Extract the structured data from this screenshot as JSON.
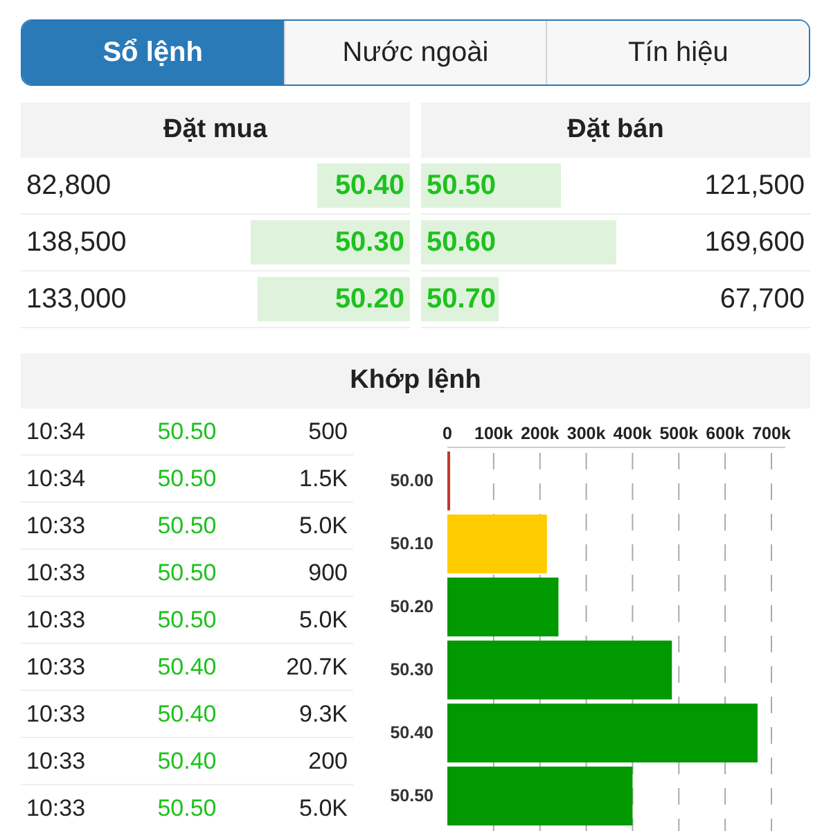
{
  "tabs": [
    {
      "label": "Sổ lệnh",
      "selected": true
    },
    {
      "label": "Nước ngoài",
      "selected": false
    },
    {
      "label": "Tín hiệu",
      "selected": false
    }
  ],
  "order_book": {
    "buy_header": "Đặt mua",
    "sell_header": "Đặt bán",
    "rows": [
      {
        "buy": {
          "volume": "82,800",
          "price": "50.40",
          "level": 0.24
        },
        "sell": {
          "price": "50.50",
          "level": 0.36,
          "volume": "121,500"
        }
      },
      {
        "buy": {
          "volume": "138,500",
          "price": "50.30",
          "level": 0.41
        },
        "sell": {
          "price": "50.60",
          "level": 0.5,
          "volume": "169,600"
        }
      },
      {
        "buy": {
          "volume": "133,000",
          "price": "50.20",
          "level": 0.39
        },
        "sell": {
          "price": "50.70",
          "level": 0.2,
          "volume": "67,700"
        }
      }
    ]
  },
  "matched": {
    "title": "Khớp lệnh",
    "trades": [
      {
        "time": "10:34",
        "price": "50.50",
        "volume": "500"
      },
      {
        "time": "10:34",
        "price": "50.50",
        "volume": "1.5K"
      },
      {
        "time": "10:33",
        "price": "50.50",
        "volume": "5.0K"
      },
      {
        "time": "10:33",
        "price": "50.50",
        "volume": "900"
      },
      {
        "time": "10:33",
        "price": "50.50",
        "volume": "5.0K"
      },
      {
        "time": "10:33",
        "price": "50.40",
        "volume": "20.7K"
      },
      {
        "time": "10:33",
        "price": "50.40",
        "volume": "9.3K"
      },
      {
        "time": "10:33",
        "price": "50.40",
        "volume": "200"
      },
      {
        "time": "10:33",
        "price": "50.50",
        "volume": "5.0K"
      }
    ],
    "chart_data": {
      "type": "bar",
      "orientation": "horizontal",
      "stacked": true,
      "grid": true,
      "categories": [
        "50.00",
        "50.10",
        "50.20",
        "50.30",
        "50.40",
        "50.50"
      ],
      "xlim": [
        0,
        700000
      ],
      "xticks": [
        {
          "value": 0,
          "label": "0"
        },
        {
          "value": 100000,
          "label": "100k"
        },
        {
          "value": 200000,
          "label": "200k"
        },
        {
          "value": 300000,
          "label": "300k"
        },
        {
          "value": 400000,
          "label": "400k"
        },
        {
          "value": 500000,
          "label": "500k"
        },
        {
          "value": 600000,
          "label": "600k"
        },
        {
          "value": 700000,
          "label": "700k"
        }
      ],
      "series": [
        {
          "color": "#c0392b",
          "values": [
            2000,
            null,
            null,
            null,
            null,
            null
          ]
        },
        {
          "color": "#ffcc00",
          "values": [
            null,
            215000,
            null,
            null,
            null,
            null
          ]
        },
        {
          "color": "#009900",
          "values": [
            null,
            null,
            240000,
            485000,
            670000,
            400000
          ]
        }
      ]
    }
  }
}
